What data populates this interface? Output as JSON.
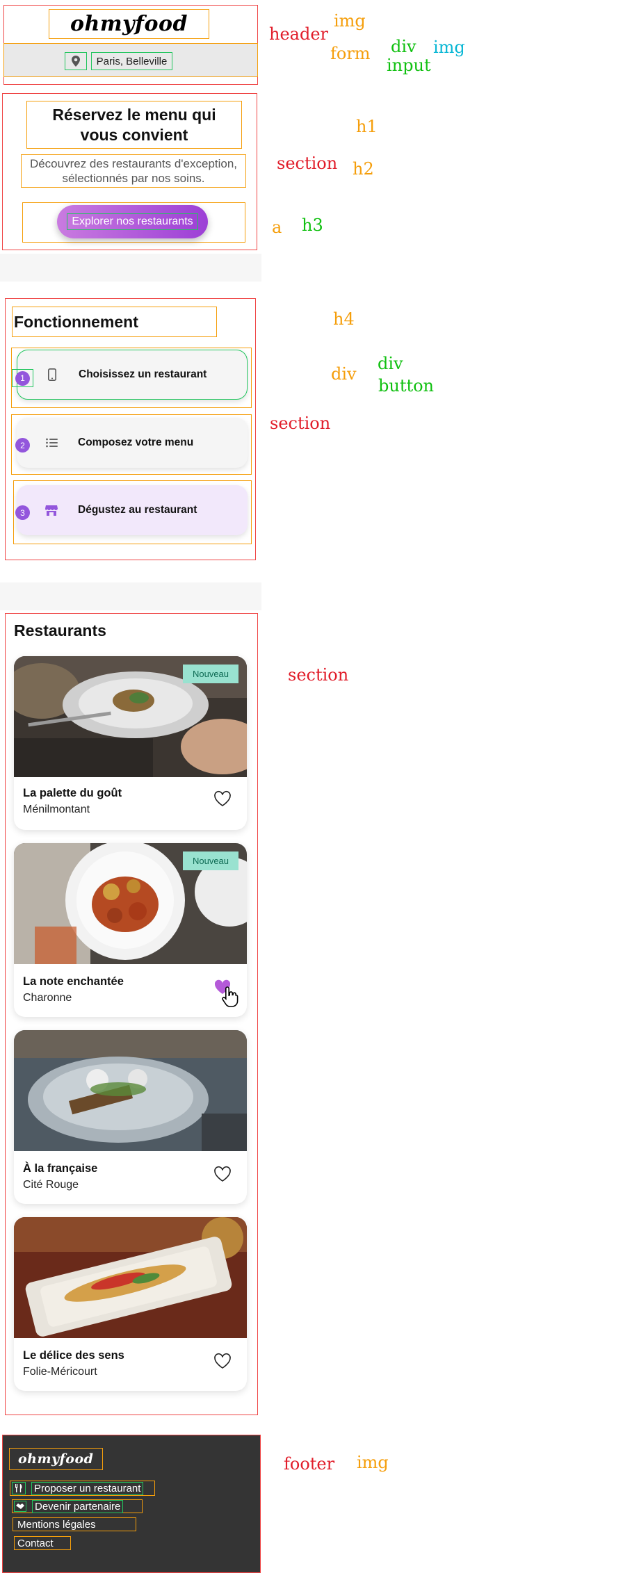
{
  "header": {
    "logo": "ohmyfood",
    "location": "Paris, Belleville",
    "location_icon": "map-pin-icon"
  },
  "hero": {
    "title": "Réservez le menu qui vous convient",
    "subtitle": "Découvrez des restaurants d'exception, sélectionnés par nos soins.",
    "cta": "Explorer nos restaurants"
  },
  "how_it_works": {
    "title": "Fonctionnement",
    "steps": [
      {
        "number": "1",
        "label": "Choisissez un restaurant",
        "icon": "mobile-phone-icon"
      },
      {
        "number": "2",
        "label": "Composez votre menu",
        "icon": "list-icon"
      },
      {
        "number": "3",
        "label": "Dégustez au restaurant",
        "icon": "store-icon"
      }
    ]
  },
  "restaurants": {
    "title": "Restaurants",
    "items": [
      {
        "name": "La palette du goût",
        "location": "Ménilmontant",
        "badge": "Nouveau",
        "liked": false
      },
      {
        "name": "La note enchantée",
        "location": "Charonne",
        "badge": "Nouveau",
        "liked": true
      },
      {
        "name": "À la française",
        "location": "Cité Rouge",
        "badge": "",
        "liked": false
      },
      {
        "name": "Le délice des sens",
        "location": "Folie-Méricourt",
        "badge": "",
        "liked": false
      }
    ]
  },
  "footer": {
    "logo": "ohmyfood",
    "links": [
      {
        "label": "Proposer un restaurant",
        "icon": "utensils-icon"
      },
      {
        "label": "Devenir partenaire",
        "icon": "handshake-icon"
      },
      {
        "label": "Mentions légales",
        "icon": ""
      },
      {
        "label": "Contact",
        "icon": ""
      }
    ]
  },
  "annotations": {
    "header": "header",
    "img": "img",
    "form": "form",
    "div": "div",
    "input": "input",
    "img2": "img",
    "h1": "h1",
    "section": "section",
    "h2": "h2",
    "a": "a",
    "h3": "h3",
    "h4": "h4",
    "div2": "div",
    "div3": "div",
    "button": "button",
    "section2": "section",
    "section3": "section",
    "footer": "footer",
    "img3": "img"
  },
  "colors": {
    "accent": "#9356dc",
    "accent_light": "#f2e8fb",
    "badge_bg": "#99e2d0",
    "badge_text": "#0e6b54",
    "footer_bg": "#343434",
    "outline_red": "#ef4444",
    "outline_orange": "#f59e0b",
    "outline_green": "#22c55e"
  }
}
